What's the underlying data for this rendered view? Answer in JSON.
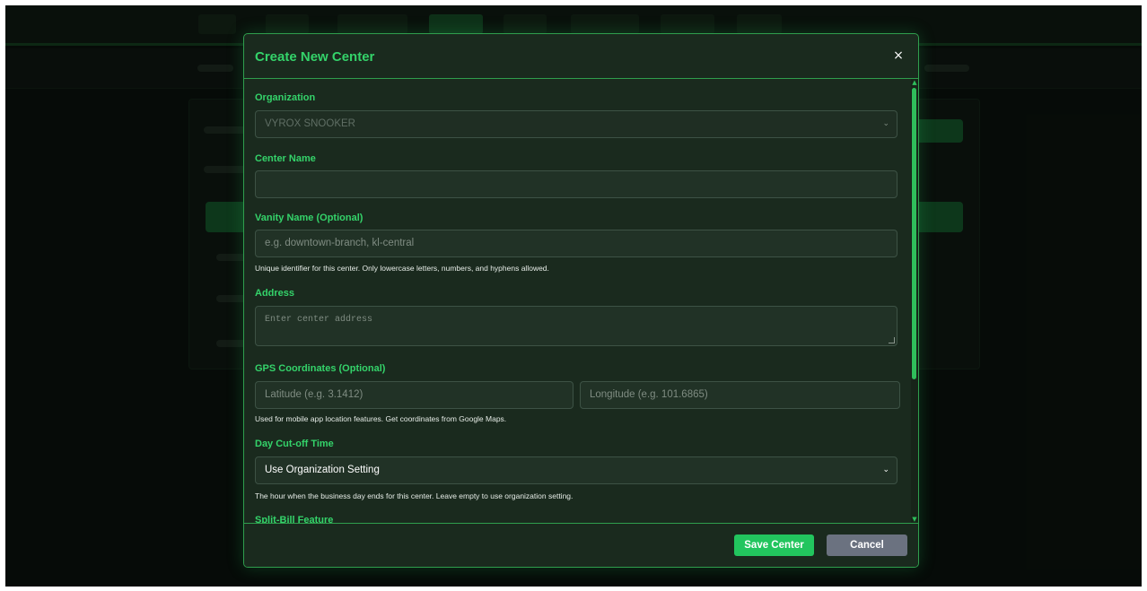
{
  "modal": {
    "title": "Create New Center",
    "close_symbol": "×",
    "organization": {
      "label": "Organization",
      "value": "VYROX SNOOKER"
    },
    "center_name": {
      "label": "Center Name",
      "value": ""
    },
    "vanity_name": {
      "label": "Vanity Name (Optional)",
      "placeholder": "e.g. downtown-branch, kl-central",
      "help": "Unique identifier for this center. Only lowercase letters, numbers, and hyphens allowed."
    },
    "address": {
      "label": "Address",
      "placeholder": "Enter center address"
    },
    "gps": {
      "label": "GPS Coordinates (Optional)",
      "latitude_placeholder": "Latitude (e.g. 3.1412)",
      "longitude_placeholder": "Longitude (e.g. 101.6865)",
      "help": "Used for mobile app location features. Get coordinates from Google Maps."
    },
    "day_cutoff": {
      "label": "Day Cut-off Time",
      "value": "Use Organization Setting",
      "help": "The hour when the business day ends for this center. Leave empty to use organization setting."
    },
    "split_bill": {
      "label": "Split-Bill Feature"
    },
    "footer": {
      "save_label": "Save Center",
      "cancel_label": "Cancel"
    }
  },
  "icons": {
    "chevron": "⌄",
    "scroll_up": "▲",
    "scroll_down": "▼"
  },
  "colors": {
    "accent": "#34d36a",
    "save_button": "#22c55e",
    "cancel_button": "#6b7280",
    "modal_border": "#2f9e4d"
  }
}
